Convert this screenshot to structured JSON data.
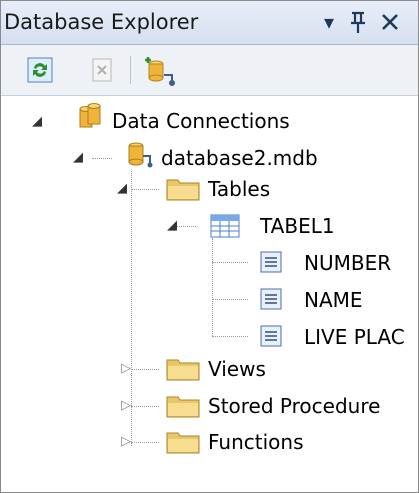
{
  "window": {
    "title": "Database Explorer",
    "buttons": [
      "▾",
      "📌",
      "✕"
    ]
  },
  "toolbar": {
    "items": [
      "refresh-icon",
      "delete-icon",
      "connect-to-database-icon"
    ]
  },
  "tree": {
    "data_connections": "Data Connections",
    "database": "database2.mdb",
    "tables": "Tables",
    "table1": "TABEL1",
    "columns": [
      "NUMBER",
      "NAME",
      "LIVE PLAC"
    ],
    "views": "Views",
    "stored_procedures": "Stored Procedure",
    "functions": "Functions"
  },
  "colors": {
    "folder": "#e9c66a",
    "db": "#f0b43a",
    "table_grid": "#4a7fc8"
  }
}
